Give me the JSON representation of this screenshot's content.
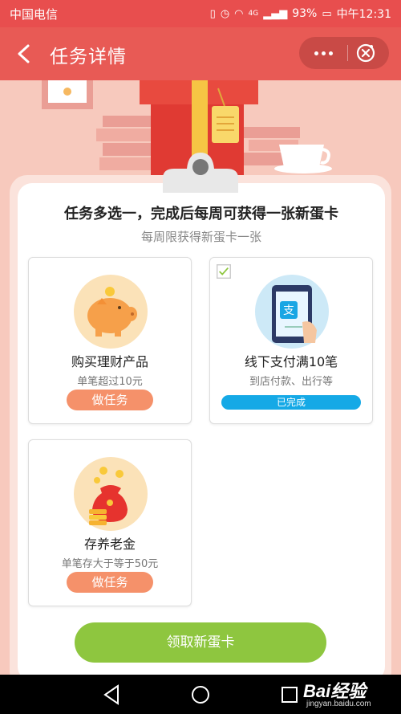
{
  "status_bar": {
    "carrier": "中国电信",
    "network": "4G",
    "battery": "93%",
    "time": "中午12:31"
  },
  "header": {
    "title": "任务详情",
    "back_icon": "chevron-left-icon",
    "more_icon": "more-dots-icon",
    "close_icon": "close-circle-icon"
  },
  "card": {
    "headline": "任务多选一，完成后每周可获得一张新蛋卡",
    "subline": "每周限获得新蛋卡一张"
  },
  "tasks": [
    {
      "title": "购买理财产品",
      "desc": "单笔超过10元",
      "button": "做任务",
      "icon": "piggy-bank-icon",
      "completed": false
    },
    {
      "title": "线下支付满10笔",
      "desc": "到店付款、出行等",
      "button": "已完成",
      "icon": "alipay-phone-icon",
      "completed": true
    },
    {
      "title": "存养老金",
      "desc": "单笔存大于等于50元",
      "button": "做任务",
      "icon": "money-bag-icon",
      "completed": false
    }
  ],
  "claim_button": "领取新蛋卡",
  "watermark": {
    "brand": "Bai经验",
    "site": "jingyan.baidu.com"
  },
  "colors": {
    "status_bar": "#e84e4e",
    "title_bar": "#e85a55",
    "do_task_button": "#f5916a",
    "done_badge": "#15a9e6",
    "claim_button": "#8ec63f"
  }
}
